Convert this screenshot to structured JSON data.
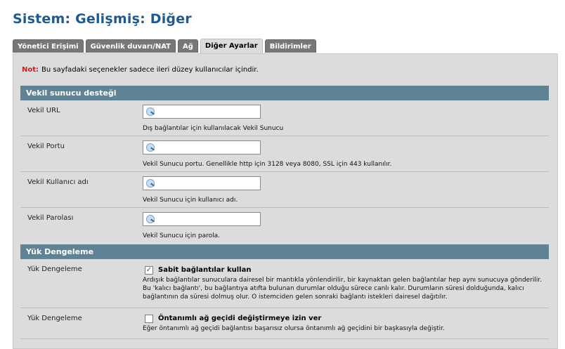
{
  "page": {
    "title": "Sistem: Gelişmiş: Diğer"
  },
  "tabs": [
    {
      "label": "Yönetici Erişimi",
      "active": false
    },
    {
      "label": "Güvenlik duvarı/NAT",
      "active": false
    },
    {
      "label": "Ağ",
      "active": false
    },
    {
      "label": "Diğer Ayarlar",
      "active": true
    },
    {
      "label": "Bildirimler",
      "active": false
    }
  ],
  "note": {
    "label": "Not:",
    "text": "Bu sayfadaki seçenekler sadece ileri düzey kullanıcılar içindir."
  },
  "proxy": {
    "section_title": "Vekil sunucu desteği",
    "fields": [
      {
        "label": "Vekil URL",
        "value": "",
        "help": "Dış bağlantılar için kullanılacak Vekil Sunucu"
      },
      {
        "label": "Vekil Portu",
        "value": "",
        "help": "Vekil Sunucu portu. Genellikle http için 3128 veya 8080, SSL için 443 kullanılır."
      },
      {
        "label": "Vekil Kullanıcı adı",
        "value": "",
        "help": "Vekil Sunucu için kullanıcı adı."
      },
      {
        "label": "Vekil Parolası",
        "value": "",
        "help": "Vekil Sunucu için parola."
      }
    ]
  },
  "load_balancing": {
    "section_title": "Yük Dengeleme",
    "options": [
      {
        "label": "Yük Dengeleme",
        "checked": true,
        "check_label": "Sabit bağlantılar kullan",
        "desc_lines": [
          "Ardışık bağlantılar sunuculara dairesel bir mantıkla yönlendirilir, bir kaynaktan gelen bağlantılar hep aynı sunucuya gönderilir.",
          "Bu 'kalıcı bağlantı', bu bağlantıya atıfta bulunan durumlar olduğu sürece canlı kalır. Durumların süresi dolduğunda, kalıcı",
          "bağlantının da süresi dolmuş olur. O istemciden gelen sonraki bağlantı istekleri dairesel dağıtılır."
        ]
      },
      {
        "label": "Yük Dengeleme",
        "checked": false,
        "check_label": "Öntanımlı ağ geçidi değiştirmeye izin ver",
        "desc_lines": [
          "Eğer öntanımlı ağ geçidi bağlantısı başarısız olursa öntanımlı ağ geçidini bir başkasıyla değiştir."
        ]
      }
    ]
  }
}
